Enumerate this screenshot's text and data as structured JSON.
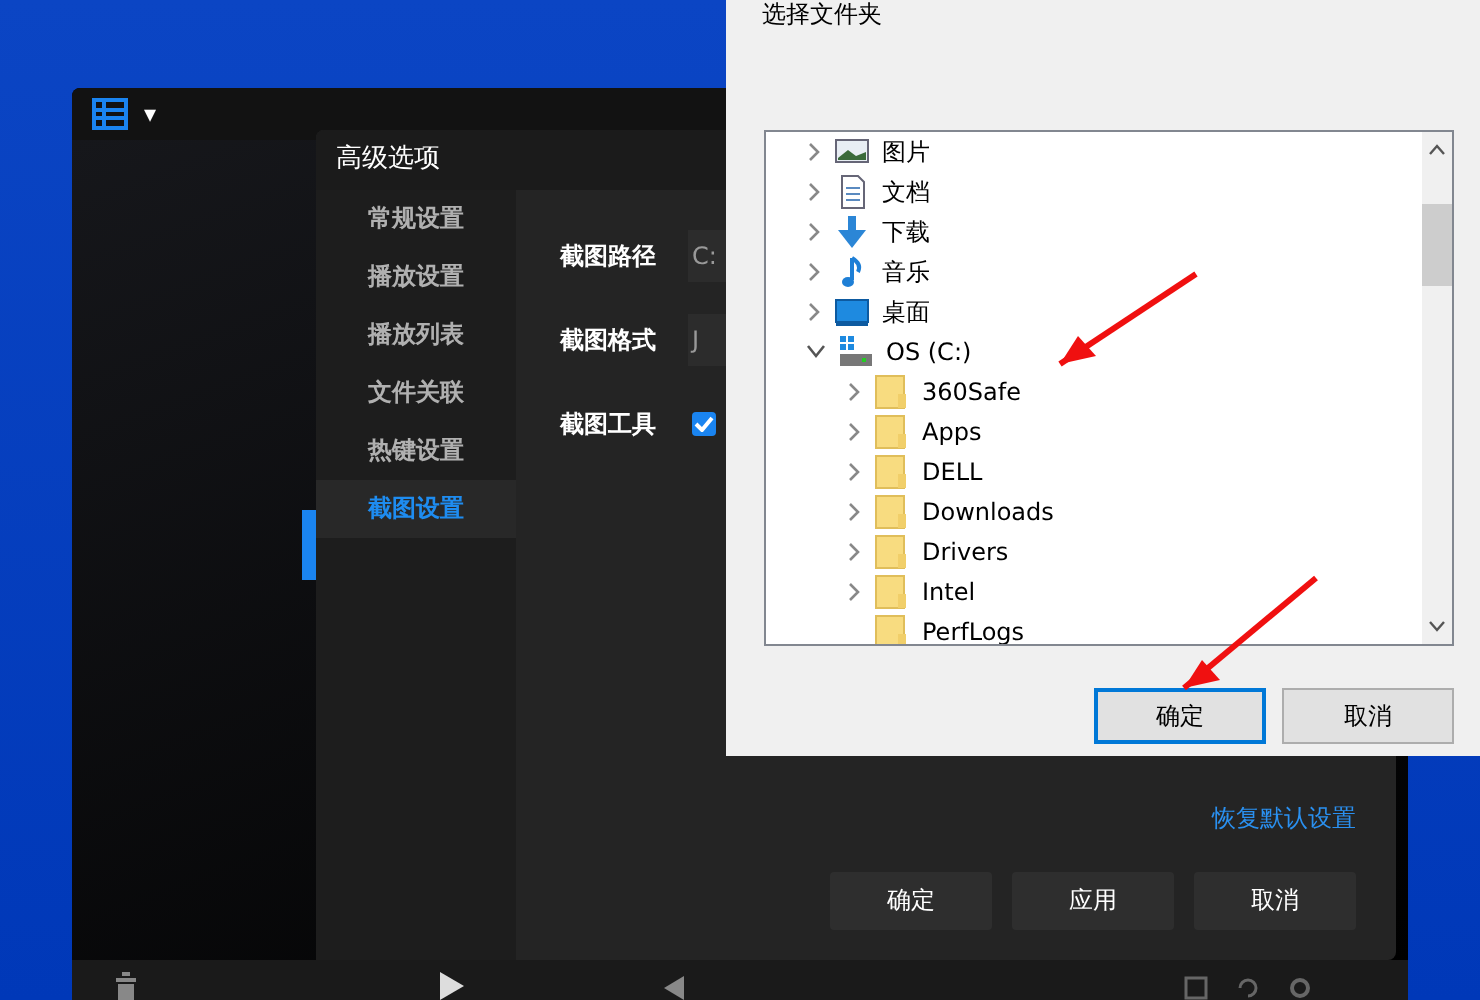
{
  "player": {
    "menu_caret": "▾"
  },
  "settings": {
    "title": "高级选项",
    "sidebar": [
      {
        "label": "常规设置",
        "selected": false
      },
      {
        "label": "播放设置",
        "selected": false
      },
      {
        "label": "播放列表",
        "selected": false
      },
      {
        "label": "文件关联",
        "selected": false
      },
      {
        "label": "热键设置",
        "selected": false
      },
      {
        "label": "截图设置",
        "selected": true
      }
    ],
    "rows": [
      {
        "kind": "field",
        "label": "截图路径",
        "value": "C:"
      },
      {
        "kind": "field",
        "label": "截图格式",
        "value": "J"
      },
      {
        "kind": "checkbox",
        "label": "截图工具",
        "checked": true
      }
    ],
    "restore_link": "恢复默认设置",
    "buttons": [
      "确定",
      "应用",
      "取消"
    ]
  },
  "folder_dialog": {
    "title": "选择文件夹",
    "tree": [
      {
        "label": "图片",
        "kind": "pictures",
        "expandable": true,
        "expanded": false
      },
      {
        "label": "文档",
        "kind": "documents",
        "expandable": true,
        "expanded": false
      },
      {
        "label": "下载",
        "kind": "downloads",
        "expandable": true,
        "expanded": false
      },
      {
        "label": "音乐",
        "kind": "music",
        "expandable": true,
        "expanded": false
      },
      {
        "label": "桌面",
        "kind": "desktop",
        "expandable": true,
        "expanded": false
      },
      {
        "label": "OS (C:)",
        "kind": "drive",
        "expandable": true,
        "expanded": true,
        "children": [
          {
            "label": "360Safe",
            "kind": "folder",
            "expandable": true,
            "expanded": false
          },
          {
            "label": "Apps",
            "kind": "folder",
            "expandable": true,
            "expanded": false
          },
          {
            "label": "DELL",
            "kind": "folder",
            "expandable": true,
            "expanded": false
          },
          {
            "label": "Downloads",
            "kind": "folder",
            "expandable": true,
            "expanded": false
          },
          {
            "label": "Drivers",
            "kind": "folder",
            "expandable": true,
            "expanded": false
          },
          {
            "label": "Intel",
            "kind": "folder",
            "expandable": true,
            "expanded": false
          },
          {
            "label": "PerfLogs",
            "kind": "folder",
            "expandable": false,
            "expanded": false
          }
        ]
      }
    ],
    "buttons": [
      {
        "label": "确定",
        "selected": true
      },
      {
        "label": "取消",
        "selected": false
      }
    ]
  }
}
